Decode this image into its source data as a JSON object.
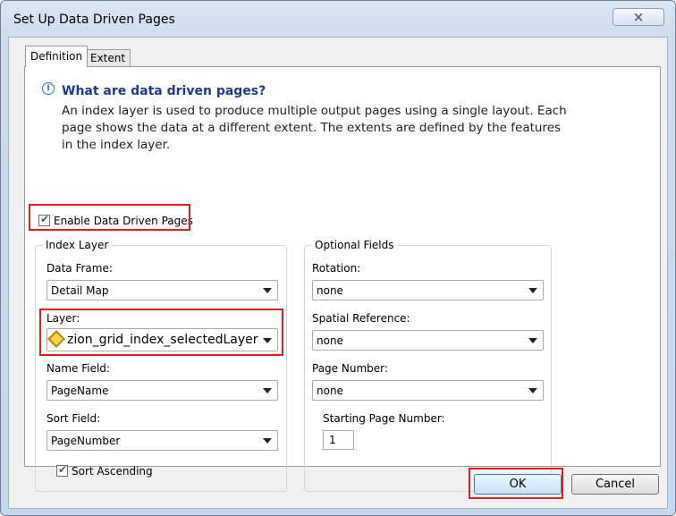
{
  "window": {
    "title": "Set Up Data Driven Pages",
    "close_glyph": "×"
  },
  "tabs": [
    {
      "label": "Definition",
      "active": true
    },
    {
      "label": "Extent",
      "active": false
    }
  ],
  "info": {
    "icon": "info-icon",
    "icon_glyph": "i",
    "heading": "What are data driven pages?",
    "text": "An index layer is used to produce multiple output pages using a single layout.  Each page shows the data at a different extent.  The extents are defined by the features in the index layer."
  },
  "enable": {
    "label": "Enable Data Driven Pages",
    "checked": true
  },
  "index_layer": {
    "title": "Index Layer",
    "data_frame": {
      "label": "Data Frame:",
      "value": "Detail Map"
    },
    "layer": {
      "label": "Layer:",
      "value": "zion_grid_index_selectedLayer"
    },
    "name_field": {
      "label": "Name Field:",
      "value": "PageName"
    },
    "sort_field": {
      "label": "Sort Field:",
      "value": "PageNumber"
    },
    "sort_ascending": {
      "label": "Sort Ascending",
      "checked": true
    }
  },
  "optional_fields": {
    "title": "Optional Fields",
    "rotation": {
      "label": "Rotation:",
      "value": "none"
    },
    "spatial_reference": {
      "label": "Spatial Reference:",
      "value": "none"
    },
    "page_number": {
      "label": "Page Number:",
      "value": "none"
    },
    "starting_page_number": {
      "label": "Starting Page Number:",
      "value": "1"
    }
  },
  "buttons": {
    "ok": "OK",
    "cancel": "Cancel"
  },
  "colors": {
    "highlight": "#e02020",
    "heading": "#1e3a8a",
    "check": "#2a5ca8"
  }
}
